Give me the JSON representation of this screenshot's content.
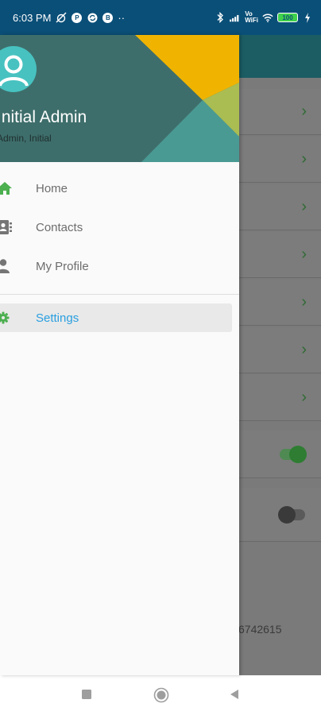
{
  "status_bar": {
    "time": "6:03 PM",
    "icons": [
      "alarm-off-icon",
      "p-icon",
      "sync-icon",
      "b-icon",
      "more-dots-icon",
      "bluetooth-icon",
      "signal-icon",
      "volte-icon",
      "wifi-icon",
      "battery-icon",
      "charging-icon"
    ],
    "p_glyph": "P",
    "b_glyph": "B",
    "more": "··",
    "volte_top": "Vo",
    "volte_bottom": "WiFi",
    "battery": "100"
  },
  "drawer": {
    "user_name": "Initial Admin",
    "user_role": "Admin, Initial",
    "menu": [
      {
        "label": "Home",
        "icon": "home-icon",
        "color": "#4caf50"
      },
      {
        "label": "Contacts",
        "icon": "contacts-icon",
        "color": "#757575"
      },
      {
        "label": "My Profile",
        "icon": "person-icon",
        "color": "#757575"
      },
      {
        "label": "Settings",
        "icon": "gear-icon",
        "color": "#4caf50",
        "active": true
      }
    ]
  },
  "background": {
    "partial_number": "6742615",
    "toggles": [
      {
        "state": "on",
        "color": "#2e7d32"
      },
      {
        "state": "off",
        "color": "#3a3a3a"
      }
    ]
  },
  "colors": {
    "status_bar": "#0a4f78",
    "drawer_header": "#3e6e6b",
    "accent_yellow": "#f0b400",
    "accent_lime": "#aabd52",
    "accent_teal": "#4a9a94",
    "active_text": "#2a9fe0"
  }
}
